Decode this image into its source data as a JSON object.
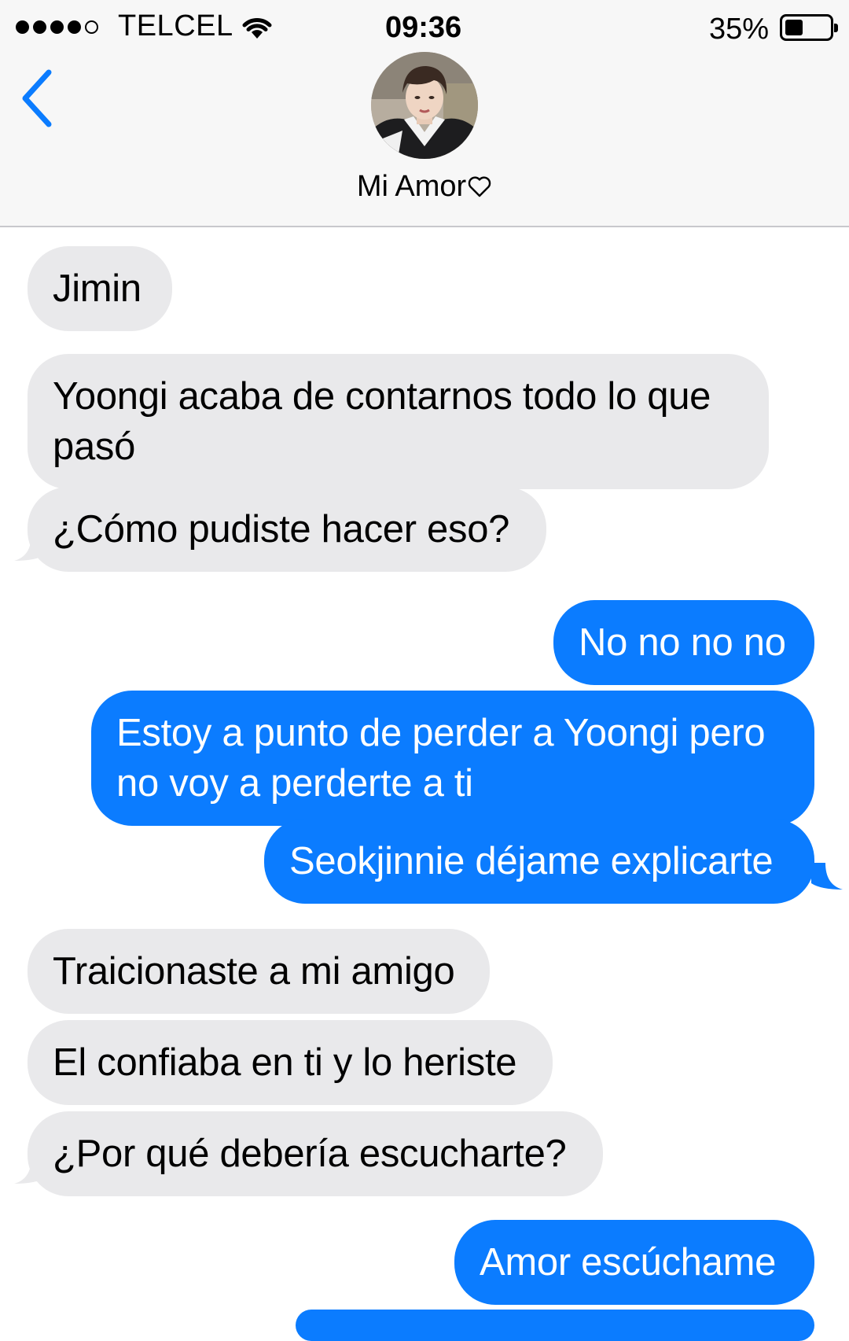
{
  "status_bar": {
    "carrier": "TELCEL",
    "time": "09:36",
    "battery_percent_label": "35%",
    "battery_level": 0.35,
    "signal_bars_filled": 4,
    "signal_bars_total": 5
  },
  "header": {
    "contact_name": "Mi Amor",
    "heart_icon": "heart-outline-icon",
    "back_icon": "chevron-left-icon"
  },
  "colors": {
    "incoming_bubble": "#e9e9eb",
    "outgoing_bubble": "#0b7cff",
    "accent": "#0b7cff"
  },
  "messages": [
    {
      "direction": "in",
      "text": "Jimin"
    },
    {
      "direction": "in",
      "text": "Yoongi acaba de contarnos todo lo que pasó"
    },
    {
      "direction": "in",
      "text": "¿Cómo pudiste hacer eso?"
    },
    {
      "direction": "out",
      "text": "No no no no"
    },
    {
      "direction": "out",
      "text": "Estoy a punto de perder a Yoongi pero no voy a perderte a ti"
    },
    {
      "direction": "out",
      "text": "Seokjinnie déjame explicarte"
    },
    {
      "direction": "in",
      "text": "Traicionaste a mi amigo"
    },
    {
      "direction": "in",
      "text": "El confiaba en ti y lo heriste"
    },
    {
      "direction": "in",
      "text": "¿Por qué debería escucharte?"
    },
    {
      "direction": "out",
      "text": "Amor escúchame"
    }
  ]
}
